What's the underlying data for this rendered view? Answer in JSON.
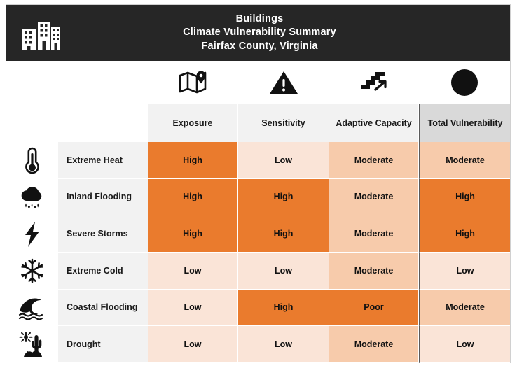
{
  "title": {
    "icon": "buildings-icon",
    "line1": "Buildings",
    "line2": "Climate Vulnerability Summary",
    "line3": "Fairfax County, Virginia"
  },
  "columns": [
    {
      "key": "hazard_icon",
      "label": "",
      "icon": ""
    },
    {
      "key": "hazard_name",
      "label": "",
      "icon": ""
    },
    {
      "key": "exposure",
      "label": "Exposure",
      "icon": "map-pin-icon"
    },
    {
      "key": "sensitivity",
      "label": "Sensitivity",
      "icon": "warning-triangle-icon"
    },
    {
      "key": "adaptive_capacity",
      "label": "Adaptive Capacity",
      "icon": "stairs-arrow-icon"
    },
    {
      "key": "total_vulnerability",
      "label": "Total Vulnerability",
      "icon": "filled-circle-icon"
    }
  ],
  "legend_colors": {
    "high": "#ea7b2d",
    "poor": "#ea7b2d",
    "moderate": "#f7cbab",
    "low": "#fae4d7",
    "header_bg": "#f2f2f2",
    "total_header_bg": "#d9d9d9",
    "title_bg": "#262626"
  },
  "rows": [
    {
      "icon": "thermometer-icon",
      "hazard": "Extreme Heat",
      "cells": [
        {
          "value": "High",
          "level": "high"
        },
        {
          "value": "Low",
          "level": "low"
        },
        {
          "value": "Moderate",
          "level": "moderate"
        },
        {
          "value": "Moderate",
          "level": "moderate"
        }
      ]
    },
    {
      "icon": "rain-cloud-icon",
      "hazard": "Inland Flooding",
      "cells": [
        {
          "value": "High",
          "level": "high"
        },
        {
          "value": "High",
          "level": "high"
        },
        {
          "value": "Moderate",
          "level": "moderate"
        },
        {
          "value": "High",
          "level": "high"
        }
      ]
    },
    {
      "icon": "lightning-bolt-icon",
      "hazard": "Severe Storms",
      "cells": [
        {
          "value": "High",
          "level": "high"
        },
        {
          "value": "High",
          "level": "high"
        },
        {
          "value": "Moderate",
          "level": "moderate"
        },
        {
          "value": "High",
          "level": "high"
        }
      ]
    },
    {
      "icon": "snowflake-icon",
      "hazard": "Extreme Cold",
      "cells": [
        {
          "value": "Low",
          "level": "low"
        },
        {
          "value": "Low",
          "level": "low"
        },
        {
          "value": "Moderate",
          "level": "moderate"
        },
        {
          "value": "Low",
          "level": "low"
        }
      ]
    },
    {
      "icon": "wave-icon",
      "hazard": "Coastal Flooding",
      "cells": [
        {
          "value": "Low",
          "level": "low"
        },
        {
          "value": "High",
          "level": "high"
        },
        {
          "value": "Poor",
          "level": "poor"
        },
        {
          "value": "Moderate",
          "level": "moderate"
        }
      ]
    },
    {
      "icon": "cactus-sun-icon",
      "hazard": "Drought",
      "cells": [
        {
          "value": "Low",
          "level": "low"
        },
        {
          "value": "Low",
          "level": "low"
        },
        {
          "value": "Moderate",
          "level": "moderate"
        },
        {
          "value": "Low",
          "level": "low"
        }
      ]
    }
  ]
}
